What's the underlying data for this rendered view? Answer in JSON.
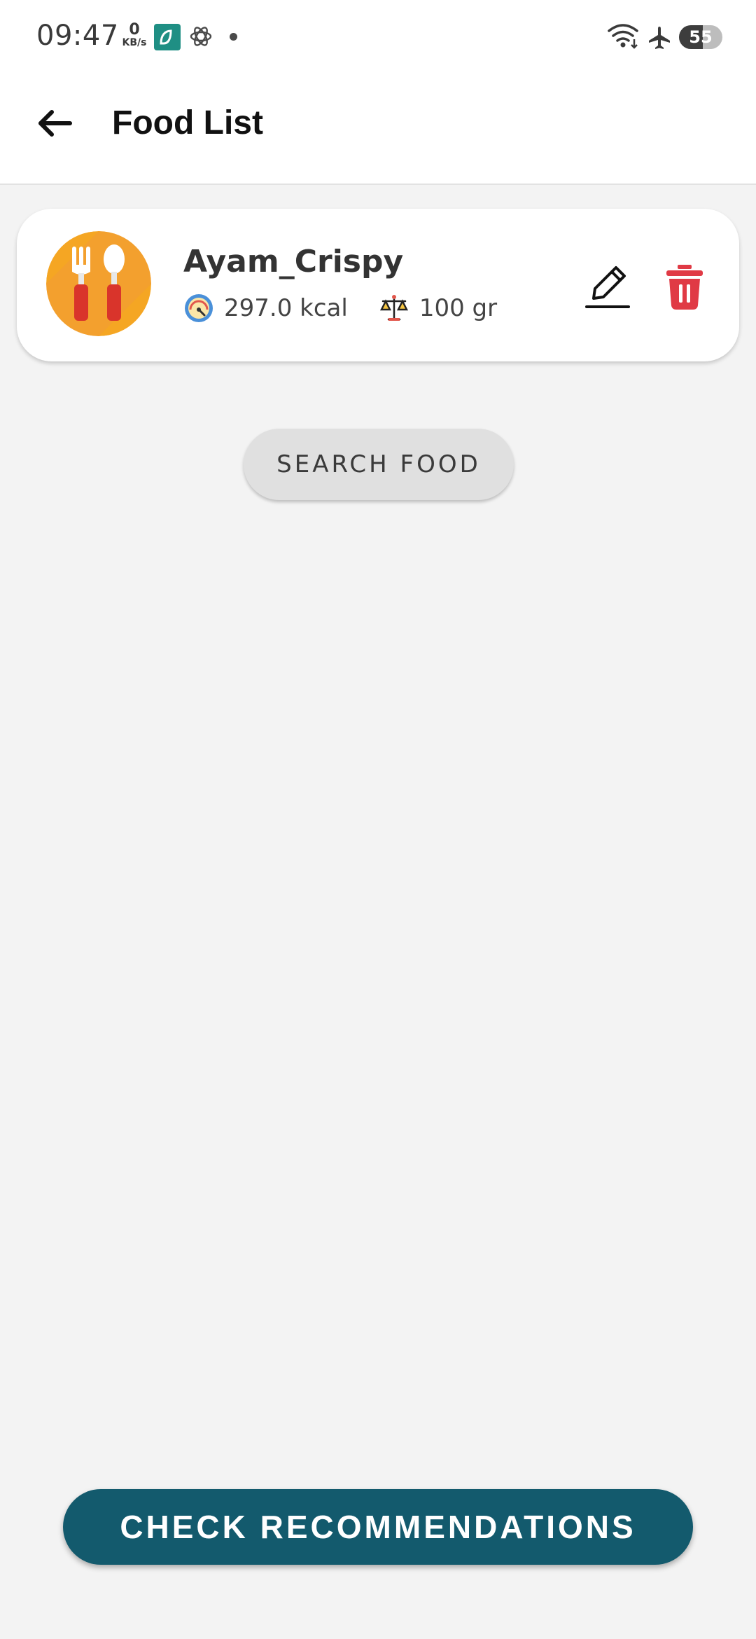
{
  "status_bar": {
    "time": "09:47",
    "net_speed_value": "0",
    "net_speed_unit": "KB/s",
    "battery_level": "55",
    "battery_fraction": 0.55,
    "icons": [
      "app-icon",
      "openai-icon",
      "notification-dot",
      "wifi-icon",
      "airplane-icon",
      "battery-icon"
    ]
  },
  "app_bar": {
    "title": "Food List",
    "back_icon": "arrow-left-icon"
  },
  "food_list": {
    "items": [
      {
        "name": "Ayam_Crispy",
        "calories": "297.0 kcal",
        "weight": "100 gr",
        "avatar_icon": "fork-spoon-icon",
        "calorie_icon": "gauge-icon",
        "weight_icon": "scale-icon",
        "edit_icon": "pencil-icon",
        "delete_icon": "trash-icon"
      }
    ]
  },
  "actions": {
    "search_food_label": "SEARCH FOOD",
    "check_recommendations_label": "CHECK RECOMMENDATIONS"
  },
  "colors": {
    "primary": "#135a6d",
    "delete": "#e03a45",
    "avatar_bg": "#f5a623"
  }
}
